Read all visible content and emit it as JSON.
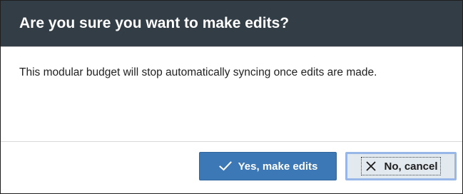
{
  "dialog": {
    "title": "Are you sure you want to make edits?",
    "message": "This modular budget will stop automatically syncing once edits are made.",
    "confirm_button": {
      "label": "Yes, make edits",
      "icon": "check-icon"
    },
    "cancel_button": {
      "label": "No, cancel",
      "icon": "close-icon"
    }
  },
  "colors": {
    "header_background": "#323d45",
    "primary_button": "#3b78b5",
    "secondary_button": "#e2e9ef",
    "focus_ring": "#96b7e8"
  }
}
